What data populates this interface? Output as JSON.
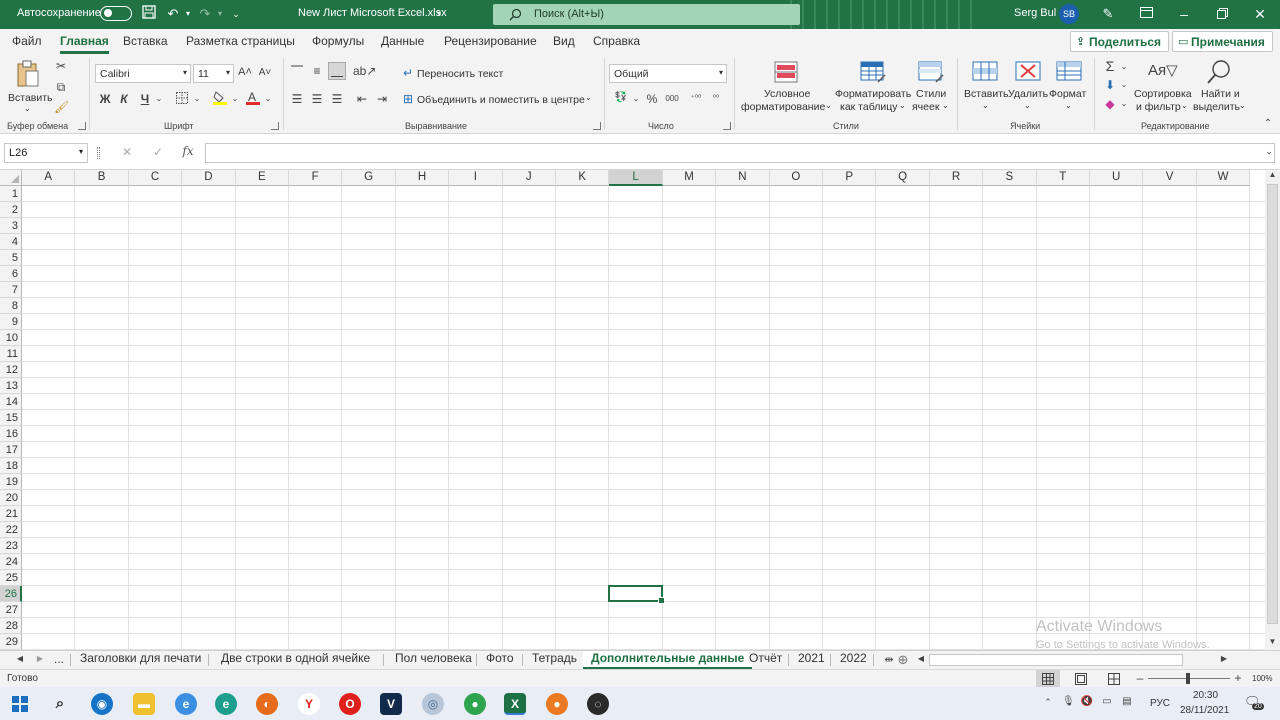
{
  "titlebar": {
    "autosave_label": "Автосохранение",
    "file_name": "New Лист Microsoft Excel.xlsx",
    "search_placeholder": "Поиск (Alt+Ы)",
    "user_name": "Serg Bul",
    "user_initials": "SB"
  },
  "menu": {
    "tabs": [
      "Файл",
      "Главная",
      "Вставка",
      "Разметка страницы",
      "Формулы",
      "Данные",
      "Рецензирование",
      "Вид",
      "Справка"
    ],
    "active_tab": "Главная",
    "share_label": "Поделиться",
    "comments_label": "Примечания"
  },
  "ribbon": {
    "clipboard": {
      "label": "Буфер обмена",
      "paste": "Вставить"
    },
    "font": {
      "label": "Шрифт",
      "family": "Calibri",
      "size": "11",
      "bold": "Ж",
      "italic": "К",
      "underline": "Ч"
    },
    "alignment": {
      "label": "Выравнивание",
      "wrap": "Переносить текст",
      "merge": "Объединить и поместить в центре"
    },
    "number": {
      "label": "Число",
      "format": "Общий"
    },
    "styles": {
      "label": "Стили",
      "conditional_1": "Условное",
      "conditional_2": "форматирование",
      "as_table_1": "Форматировать",
      "as_table_2": "как таблицу",
      "cell_styles_1": "Стили",
      "cell_styles_2": "ячеек"
    },
    "cells": {
      "label": "Ячейки",
      "insert": "Вставить",
      "delete": "Удалить",
      "format": "Формат"
    },
    "editing": {
      "label": "Редактирование",
      "sort_1": "Сортировка",
      "sort_2": "и фильтр",
      "find_1": "Найти и",
      "find_2": "выделить"
    }
  },
  "formula_bar": {
    "name_box": "L26",
    "formula": ""
  },
  "grid": {
    "columns": [
      "A",
      "B",
      "C",
      "D",
      "E",
      "F",
      "G",
      "H",
      "I",
      "J",
      "K",
      "L",
      "M",
      "N",
      "O",
      "P",
      "Q",
      "R",
      "S",
      "T",
      "U",
      "V",
      "W"
    ],
    "rows": [
      "1",
      "2",
      "3",
      "4",
      "5",
      "6",
      "7",
      "8",
      "9",
      "10",
      "11",
      "12",
      "13",
      "14",
      "15",
      "16",
      "17",
      "18",
      "19",
      "20",
      "21",
      "22",
      "23",
      "24",
      "25",
      "26",
      "27",
      "28",
      "29"
    ],
    "selected_column": "L",
    "selected_row": "26"
  },
  "sheets": {
    "ellipsis": "...",
    "tabs": [
      "Заголовки для печати",
      "Две строки в одной ячейке",
      "Пол человека",
      "Фото",
      "Тетрадь",
      "Дополнительные данные",
      "Отчёт",
      "2021",
      "2022"
    ],
    "active": "Дополнительные данные"
  },
  "status": {
    "ready": "Готово",
    "zoom": "100%"
  },
  "watermark": {
    "line1": "Activate Windows",
    "line2": "Go to Settings to activate Windows."
  },
  "taskbar": {
    "lang": "РУС",
    "time": "20:30",
    "date": "28/11/2021",
    "notifications": "20"
  },
  "colors": {
    "accent": "#217346",
    "search_bg": "#a4d4b8"
  }
}
